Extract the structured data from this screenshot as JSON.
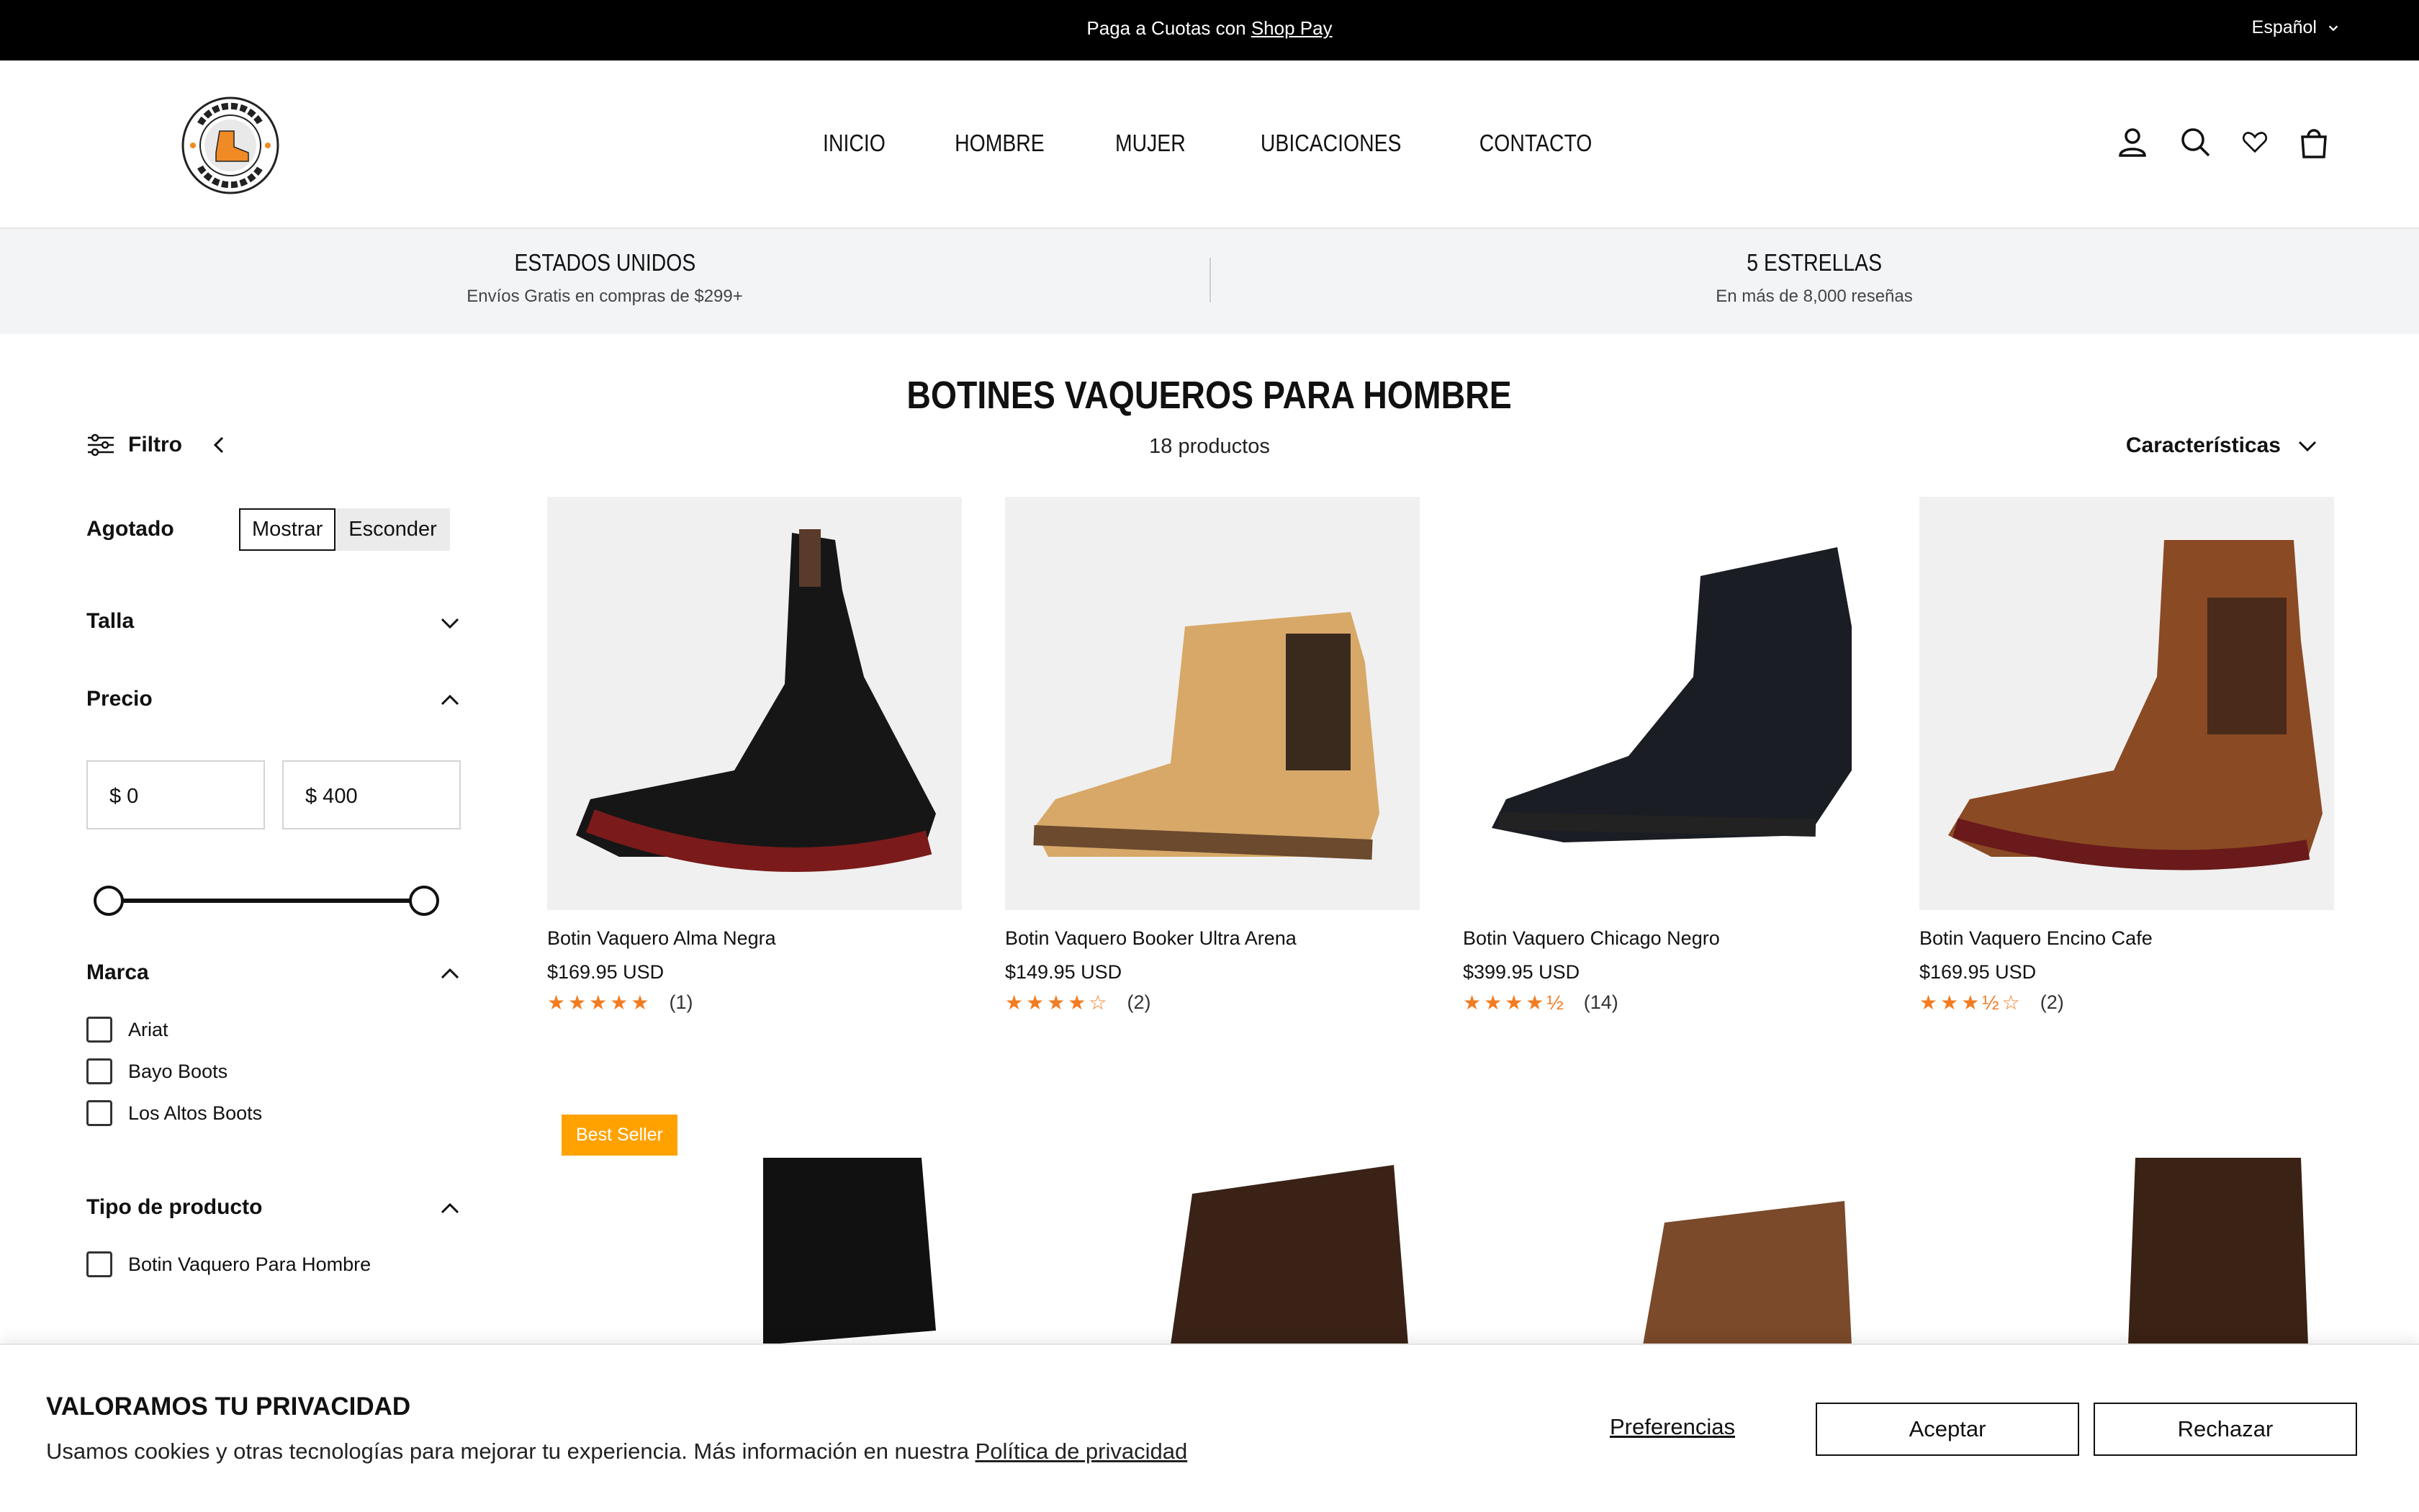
{
  "announcement": {
    "text": "Paga a Cuotas con ",
    "link": "Shop Pay",
    "language": "Español"
  },
  "header": {
    "logo_alt": "BOTINES CHARROS",
    "nav": [
      "INICIO",
      "HOMBRE",
      "MUJER",
      "UBICACIONES",
      "CONTACTO"
    ],
    "icons": [
      "account-icon",
      "search-icon",
      "wishlist-icon",
      "cart-icon"
    ]
  },
  "usp": {
    "left_title": "ESTADOS UNIDOS",
    "left_sub": "Envíos Gratis en compras de $299+",
    "right_title": "5 ESTRELLAS",
    "right_sub": "En más de 8,000 reseñas"
  },
  "collection": {
    "title": "BOTINES VAQUEROS PARA HOMBRE",
    "count": "18 productos",
    "filter_label": "Filtro",
    "sort_label": "Características"
  },
  "filters": {
    "agotado_label": "Agotado",
    "agotado_options": [
      "Mostrar",
      "Esconder"
    ],
    "talla_label": "Talla",
    "precio_label": "Precio",
    "price_min": "$ 0",
    "price_max": "$ 400",
    "marca_label": "Marca",
    "marcas": [
      "Ariat",
      "Bayo Boots",
      "Los Altos Boots"
    ],
    "tipo_label": "Tipo de producto",
    "tipos": [
      "Botin Vaquero Para Hombre"
    ]
  },
  "products": [
    {
      "name": "Botin Vaquero Alma Negra",
      "price": "$169.95 USD",
      "stars": "★★★★★",
      "reviews": "(1)",
      "rating": 5
    },
    {
      "name": "Botin Vaquero Booker Ultra Arena",
      "price": "$149.95 USD",
      "stars": "★★★★☆",
      "reviews": "(2)",
      "rating": 4
    },
    {
      "name": "Botin Vaquero Chicago Negro",
      "price": "$399.95 USD",
      "stars": "★★★★½",
      "reviews": "(14)",
      "rating": 4.5
    },
    {
      "name": "Botin Vaquero Encino Cafe",
      "price": "$169.95 USD",
      "stars": "★★★½☆",
      "reviews": "(2)",
      "rating": 3.5
    }
  ],
  "row2": {
    "badge": "Best Seller"
  },
  "cookie": {
    "title": "VALORAMOS TU PRIVACIDAD",
    "text": "Usamos cookies y otras tecnologías para mejorar tu experiencia. Más información en nuestra ",
    "link": "Política de privacidad",
    "preferences": "Preferencias",
    "accept": "Aceptar",
    "reject": "Rechazar"
  },
  "colors": {
    "star": "#f47b20",
    "badge": "#ffa200",
    "announce_bg": "#000000"
  }
}
